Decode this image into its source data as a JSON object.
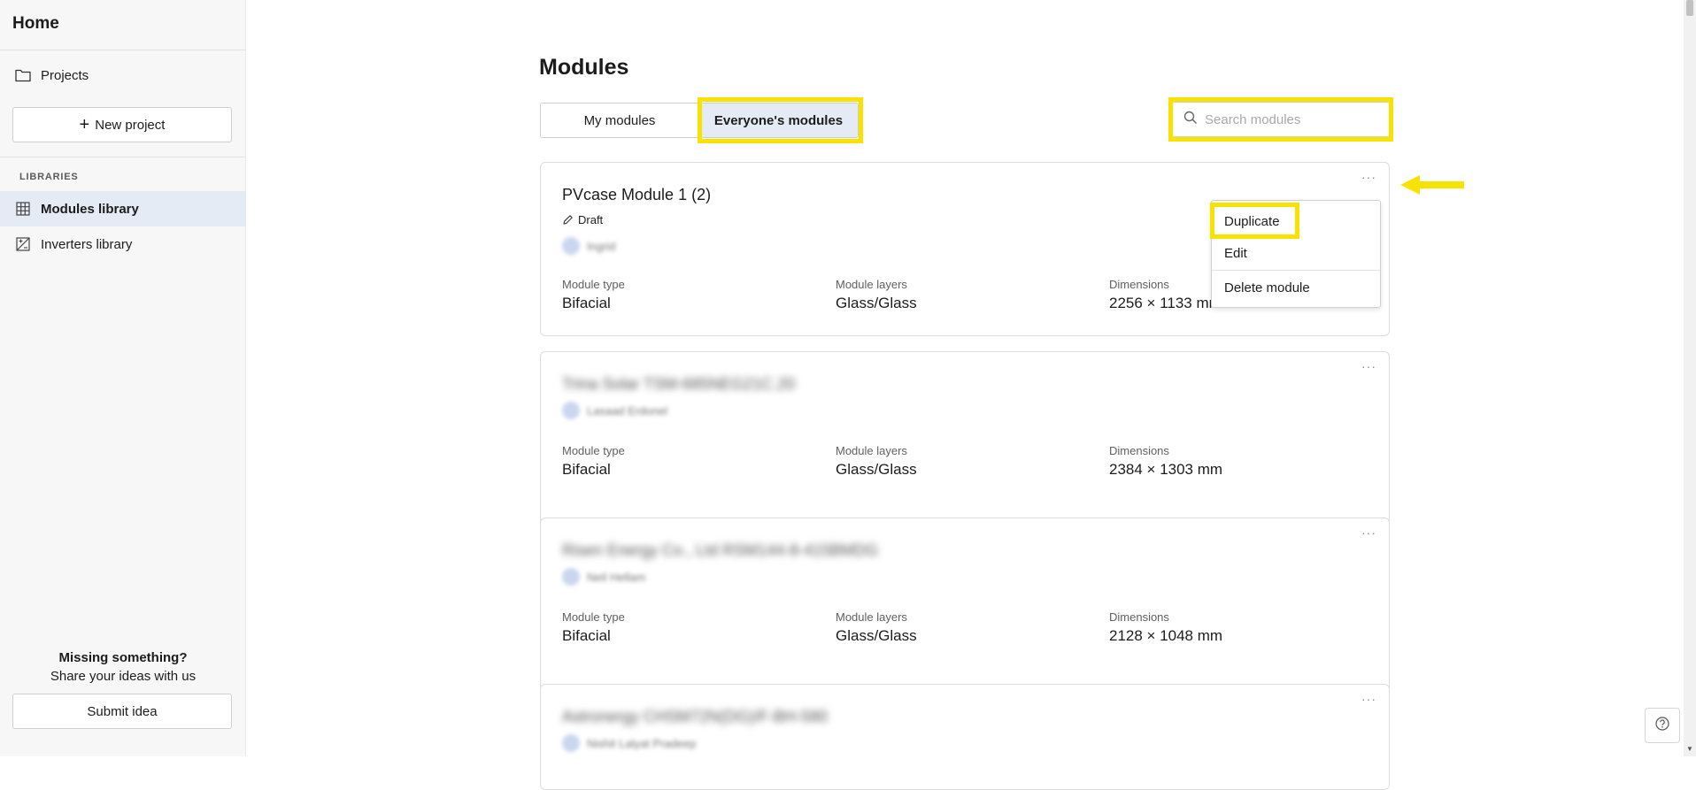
{
  "sidebar": {
    "home": "Home",
    "projects": "Projects",
    "new_project": "New project",
    "libraries_heading": "LIBRARIES",
    "items": [
      {
        "label": "Modules library",
        "icon": "grid-icon"
      },
      {
        "label": "Inverters library",
        "icon": "image-icon"
      }
    ],
    "missing_title": "Missing something?",
    "missing_sub": "Share your ideas with us",
    "submit_idea": "Submit idea"
  },
  "main": {
    "title": "Modules",
    "tabs": [
      {
        "label": "My modules"
      },
      {
        "label": "Everyone's modules",
        "selected": true
      }
    ],
    "search": {
      "placeholder": "Search modules",
      "value": ""
    }
  },
  "labels": {
    "module_type": "Module type",
    "module_layers": "Module layers",
    "dimensions": "Dimensions"
  },
  "cards": [
    {
      "title": "PVcase Module 1 (2)",
      "status": "Draft",
      "owner": "Ingrid",
      "module_type": "Bifacial",
      "module_layers": "Glass/Glass",
      "dimensions": "2256 × 1133 mm"
    },
    {
      "title": "Trina Solar TSM-685NEG21C.20",
      "owner": "Lasaad Erdonel",
      "module_type": "Bifacial",
      "module_layers": "Glass/Glass",
      "dimensions": "2384 × 1303 mm"
    },
    {
      "title": "Risen Energy Co., Ltd RSM144-8-415BMDG",
      "owner": "Neil Hellam",
      "module_type": "Bifacial",
      "module_layers": "Glass/Glass",
      "dimensions": "2128 × 1048 mm"
    },
    {
      "title": "Astronergy CHSM72N(DG)/F-BH-580",
      "owner": "Nishit Lalyat Pradeep"
    }
  ],
  "more_label": "···",
  "context_menu": {
    "items": [
      "Duplicate",
      "Edit",
      "Delete module"
    ]
  },
  "colors": {
    "highlight": "#f7e200",
    "selected_bg": "#e5ebf4",
    "sidebar_bg": "#f7f7f7"
  }
}
